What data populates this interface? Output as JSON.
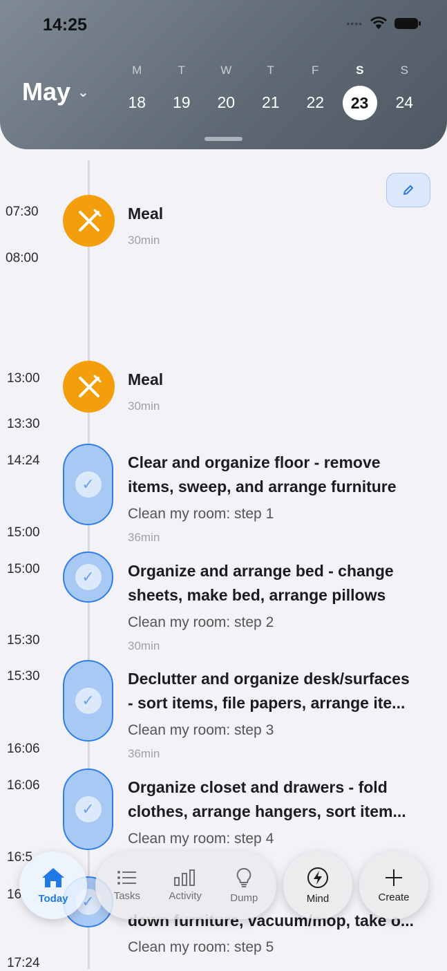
{
  "status": {
    "time": "14:25"
  },
  "calendar": {
    "month": "May",
    "days": [
      {
        "letter": "M",
        "num": "18"
      },
      {
        "letter": "T",
        "num": "19"
      },
      {
        "letter": "W",
        "num": "20"
      },
      {
        "letter": "T",
        "num": "21"
      },
      {
        "letter": "F",
        "num": "22"
      },
      {
        "letter": "S",
        "num": "23",
        "selected": true
      },
      {
        "letter": "S",
        "num": "24"
      }
    ]
  },
  "timeline": {
    "times": [
      "07:30",
      "08:00",
      "13:00",
      "13:30",
      "14:24",
      "15:00",
      "15:00",
      "15:30",
      "15:30",
      "16:06",
      "16:06",
      "16:5",
      "16",
      "17:24"
    ],
    "events": [
      {
        "title": "Meal",
        "duration": "30min",
        "type": "meal"
      },
      {
        "title": "Meal",
        "duration": "30min",
        "type": "meal"
      },
      {
        "title_line1": "Clear and organize floor - remove",
        "title_line2": "items, sweep, and arrange furniture",
        "subtitle": "Clean my room: step 1",
        "duration": "36min"
      },
      {
        "title_line1": "Organize and arrange bed - change",
        "title_line2": "sheets, make bed, arrange pillows",
        "subtitle": "Clean my room: step 2",
        "duration": "30min"
      },
      {
        "title_line1": "Declutter and organize desk/surfaces",
        "title_line2": "- sort items, file papers, arrange ite...",
        "subtitle": "Clean my room: step 3",
        "duration": "36min"
      },
      {
        "title_line1": "Organize closet and drawers - fold",
        "title_line2": "clothes, arrange hangers, sort item...",
        "subtitle": "Clean my room: step 4",
        "duration": ""
      },
      {
        "title_line2": "down furniture, vacuum/mop, take o...",
        "subtitle": "Clean my room: step 5"
      }
    ]
  },
  "nav": {
    "today": "Today",
    "tasks": "Tasks",
    "activity": "Activity",
    "dump": "Dump",
    "mind": "Mind",
    "create": "Create"
  },
  "colors": {
    "accent": "#2f7ee8",
    "meal": "#f59e0b",
    "header": "#5d6873"
  }
}
